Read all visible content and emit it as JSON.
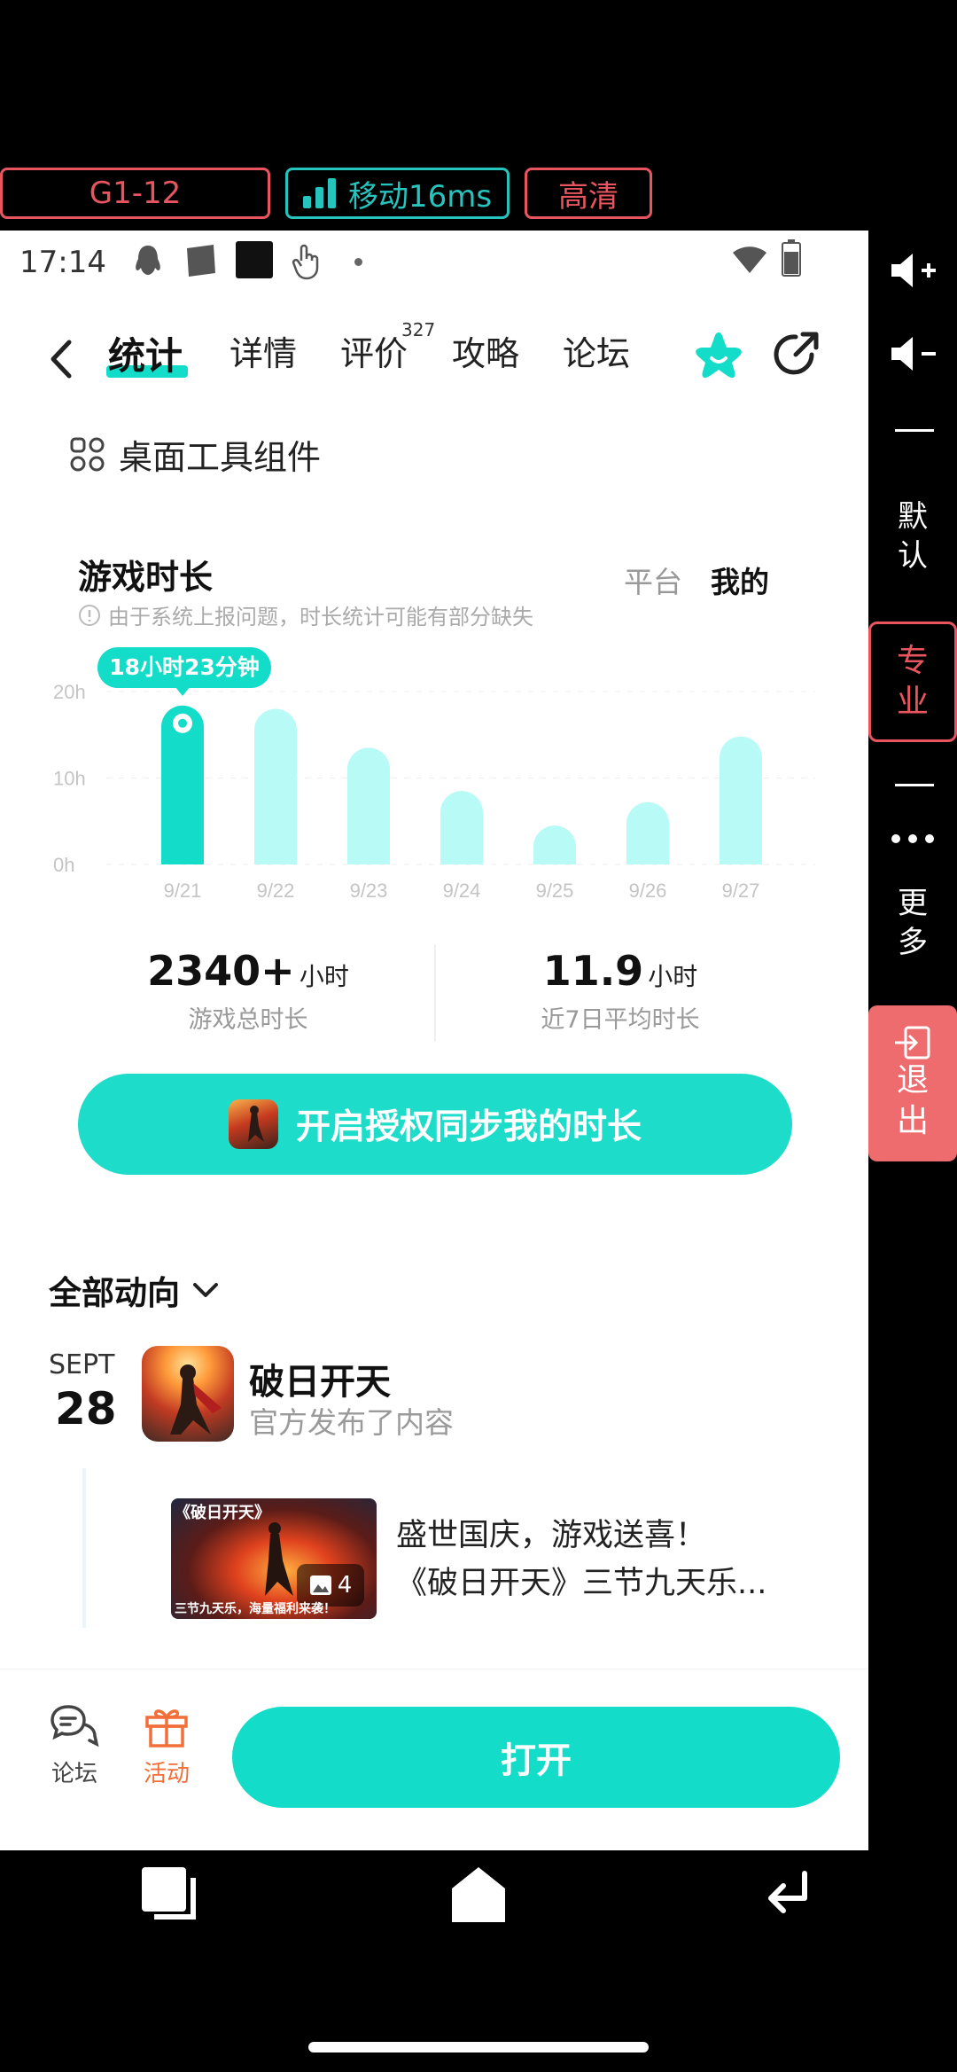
{
  "stream": {
    "device": "G1-12",
    "network": "移动16ms",
    "quality": "高清"
  },
  "side": {
    "default": "默\n认",
    "pro": "专\n业",
    "more": "更\n多",
    "exit": "退\n出"
  },
  "status": {
    "time": "17:14"
  },
  "nav": {
    "tabs": [
      "统计",
      "详情",
      "评价",
      "攻略",
      "论坛"
    ],
    "review_count": "327"
  },
  "widget": {
    "label": "桌面工具组件"
  },
  "playtime": {
    "title": "游戏时长",
    "platform": "平台",
    "mine": "我的",
    "notice": "由于系统上报问题，时长统计可能有部分缺失",
    "tooltip": "18小时23分钟"
  },
  "chart_data": {
    "type": "bar",
    "categories": [
      "9/21",
      "9/22",
      "9/23",
      "9/24",
      "9/25",
      "9/26",
      "9/27"
    ],
    "values": [
      18.38,
      18,
      13.5,
      8.5,
      4.5,
      7.2,
      14.8
    ],
    "ytick_labels": [
      "0h",
      "10h",
      "20h"
    ],
    "ylim": [
      0,
      20
    ],
    "highlight_index": 0,
    "colors": {
      "highlight": "#13dcc9",
      "normal": "#b8fbf6"
    }
  },
  "stats": {
    "total_value": "2340+",
    "total_unit": "小时",
    "total_label": "游戏总时长",
    "avg_value": "11.9",
    "avg_unit": "小时",
    "avg_label": "近7日平均时长"
  },
  "sync_button": "开启授权同步我的时长",
  "feed": {
    "title": "全部动向",
    "month": "SEPT",
    "day": "28",
    "game_name": "破日开天",
    "subtitle": "官方发布了内容",
    "post_line1": "盛世国庆，游戏送喜！",
    "post_line2": "《破日开天》三节九天乐...",
    "image_count": "4",
    "image_title": "《破日开天》",
    "image_caption": "三节九天乐，海量福利来袭！"
  },
  "bottom": {
    "forum": "论坛",
    "activity": "活动",
    "open": "打开"
  },
  "colors": {
    "accent": "#13dcc9",
    "orange": "#f26f3a",
    "red": "#e8555e"
  }
}
